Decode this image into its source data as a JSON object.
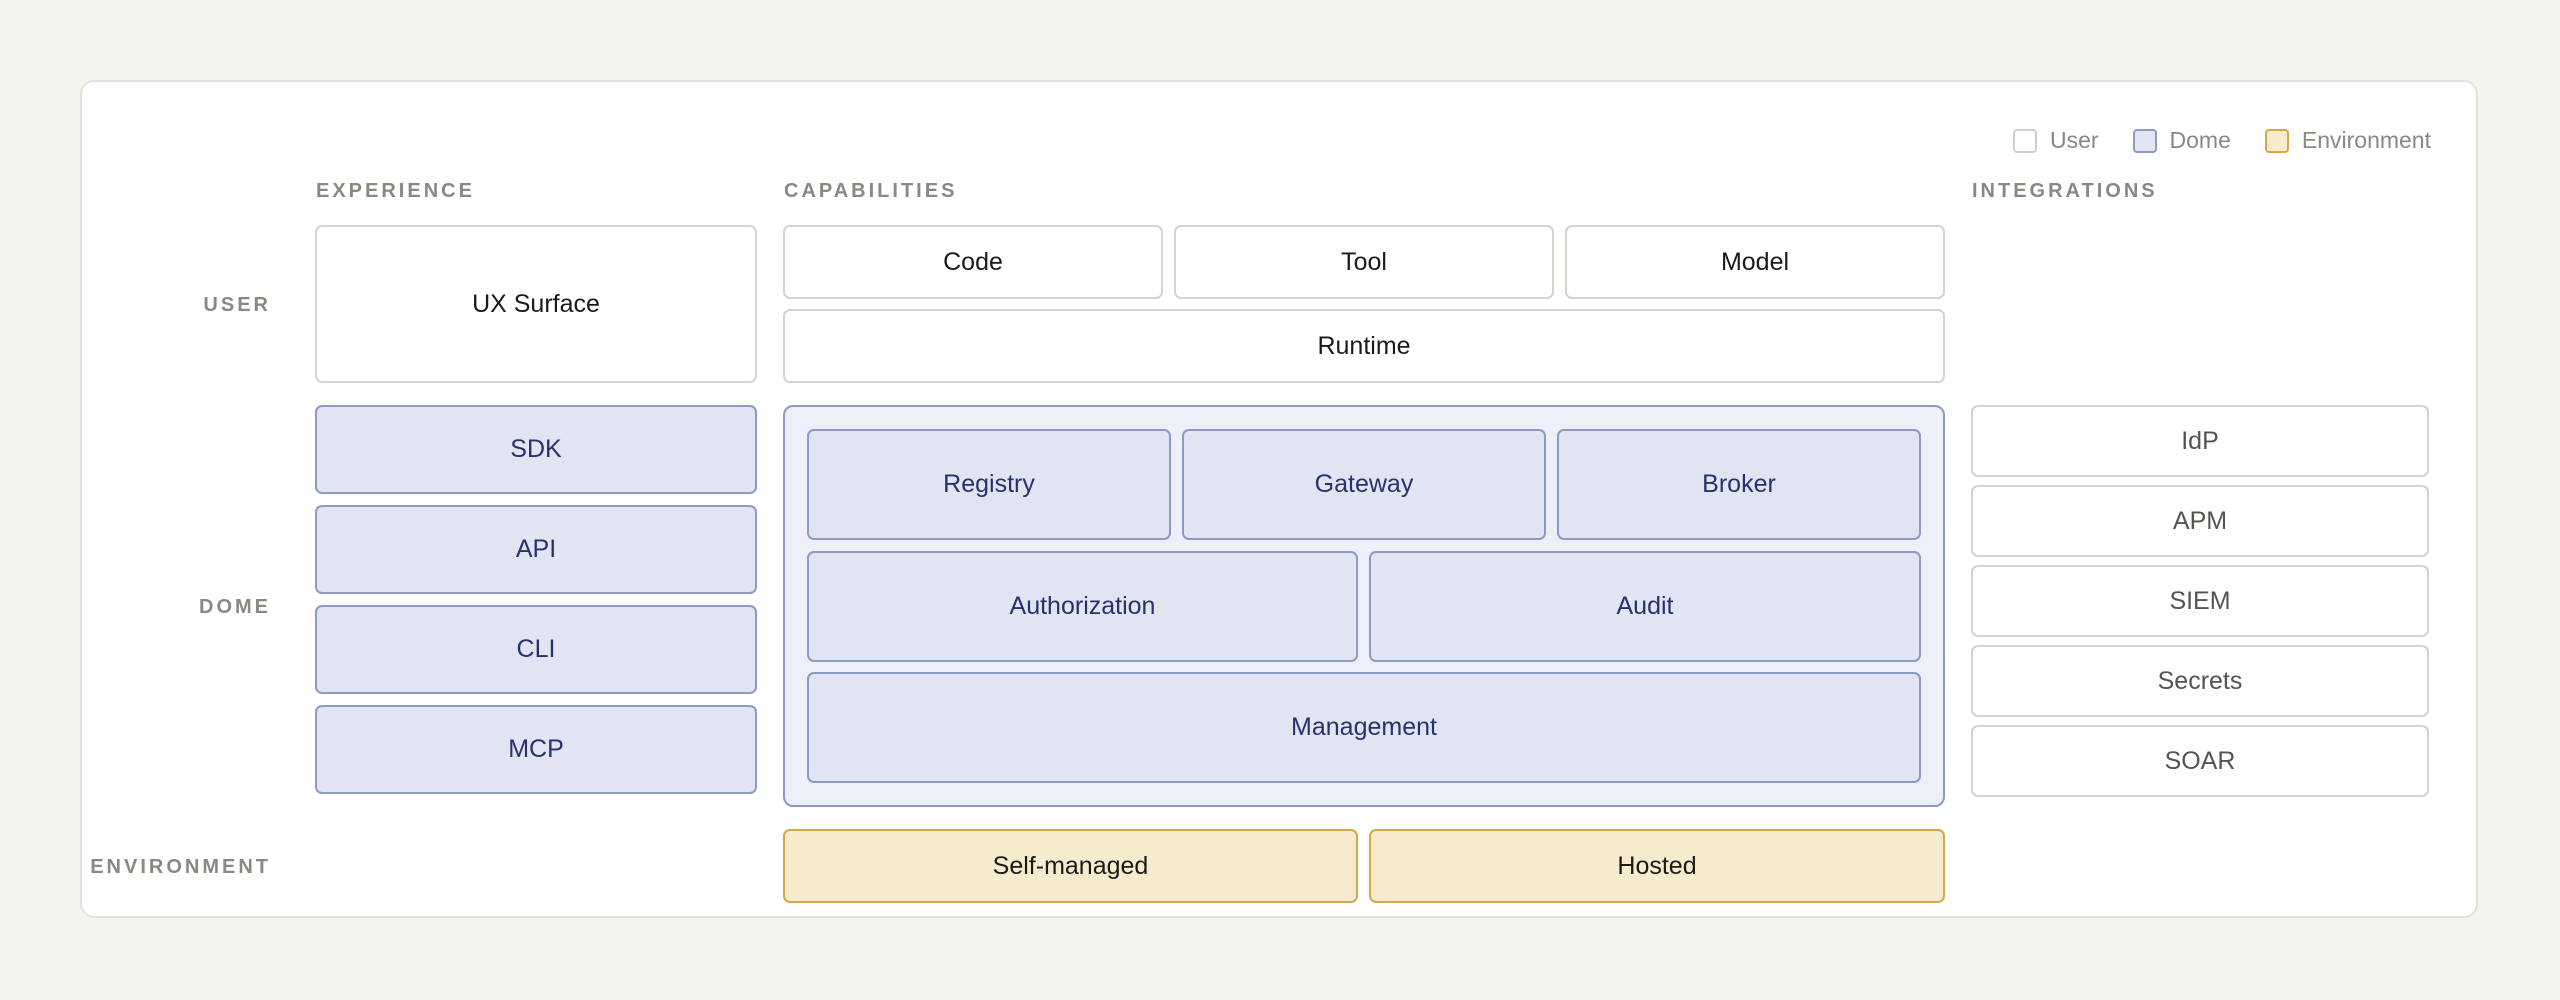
{
  "legend": [
    {
      "label": "User",
      "kind": "user"
    },
    {
      "label": "Dome",
      "kind": "dome"
    },
    {
      "label": "Environment",
      "kind": "env"
    }
  ],
  "columns": {
    "experience": "EXPERIENCE",
    "capabilities": "CAPABILITIES",
    "integrations": "INTEGRATIONS"
  },
  "rows": {
    "user": "USER",
    "dome": "DOME",
    "environment": "ENVIRONMENT"
  },
  "user_layer": {
    "ux_surface": "UX Surface",
    "code": "Code",
    "tool": "Tool",
    "model": "Model",
    "runtime": "Runtime"
  },
  "dome_layer": {
    "experience": [
      "SDK",
      "API",
      "CLI",
      "MCP"
    ],
    "capabilities": {
      "registry": "Registry",
      "gateway": "Gateway",
      "broker": "Broker",
      "authorization": "Authorization",
      "audit": "Audit",
      "management": "Management"
    }
  },
  "integrations": [
    "IdP",
    "APM",
    "SIEM",
    "Secrets",
    "SOAR"
  ],
  "environment_layer": {
    "self_managed": "Self-managed",
    "hosted": "Hosted"
  },
  "colors": {
    "user_border": "#d4d3cd",
    "dome_fill": "#e1e5f1",
    "dome_border": "#8d9ac4",
    "dome_text": "#25326e",
    "env_fill": "#f7ebcd",
    "env_border": "#d4a84f"
  }
}
